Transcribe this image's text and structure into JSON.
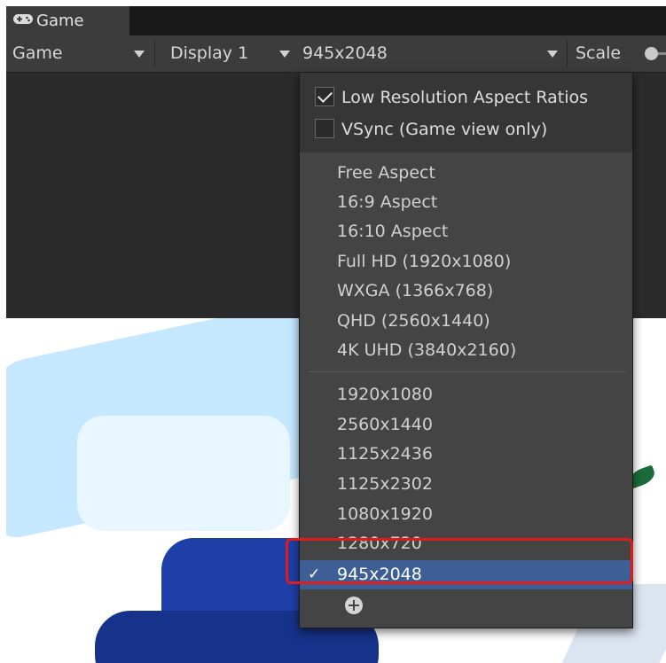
{
  "window": {
    "tab_label": "Game",
    "tab_icon": "gamepad-icon"
  },
  "toolbar": {
    "mode_label": "Game",
    "display_label": "Display 1",
    "resolution_label": "945x2048",
    "scale_label": "Scale"
  },
  "dropdown": {
    "options": [
      {
        "label": "Low Resolution Aspect Ratios",
        "checked": true
      },
      {
        "label": "VSync (Game view only)",
        "checked": false
      }
    ],
    "builtin_items": [
      "Free Aspect",
      "16:9 Aspect",
      "16:10 Aspect",
      "Full HD (1920x1080)",
      "WXGA (1366x768)",
      "QHD (2560x1440)",
      "4K UHD (3840x2160)"
    ],
    "custom_items": [
      "1920x1080",
      "2560x1440",
      "1125x2436",
      "1125x2302",
      "1080x1920",
      "1280x720"
    ],
    "selected_item": "945x2048",
    "selected_mark": "✓",
    "add_icon": "plus-circle-icon"
  },
  "colors": {
    "selected_bg": "#3e5f96",
    "highlight_border": "#e01b1b",
    "menu_bg": "#444444",
    "toolbar_bg": "#3c3c3c"
  }
}
